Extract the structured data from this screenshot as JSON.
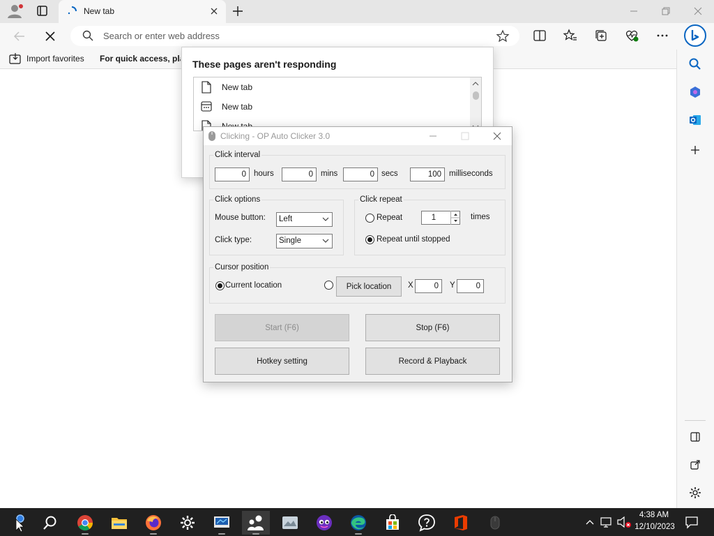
{
  "browser": {
    "tab": {
      "title": "New tab"
    },
    "address_bar": {
      "placeholder": "Search or enter web address"
    },
    "favorites_bar": {
      "import_label": "Import favorites",
      "quick_access_text": "For quick access, plac"
    }
  },
  "not_responding_dialog": {
    "title": "These pages aren't responding",
    "items": [
      {
        "label": "New tab",
        "icon": "page-icon"
      },
      {
        "label": "New tab",
        "icon": "app-window-icon"
      },
      {
        "label": "New tab",
        "icon": "page-icon"
      }
    ]
  },
  "auto_clicker": {
    "window_title": "Clicking - OP Auto Clicker 3.0",
    "click_interval": {
      "group_label": "Click interval",
      "hours": "0",
      "hours_label": "hours",
      "mins": "0",
      "mins_label": "mins",
      "secs": "0",
      "secs_label": "secs",
      "milliseconds": "100",
      "milliseconds_label": "milliseconds"
    },
    "click_options": {
      "group_label": "Click options",
      "mouse_button_label": "Mouse button:",
      "mouse_button_value": "Left",
      "click_type_label": "Click type:",
      "click_type_value": "Single"
    },
    "click_repeat": {
      "group_label": "Click repeat",
      "repeat_label": "Repeat",
      "repeat_count": "1",
      "times_label": "times",
      "repeat_until_stopped_label": "Repeat until stopped",
      "selected": "repeat_until_stopped"
    },
    "cursor_position": {
      "group_label": "Cursor position",
      "current_location_label": "Current location",
      "pick_location_label": "Pick location",
      "x_label": "X",
      "x_value": "0",
      "y_label": "Y",
      "y_value": "0",
      "selected": "current_location"
    },
    "buttons": {
      "start": "Start (F6)",
      "stop": "Stop (F6)",
      "hotkey": "Hotkey setting",
      "record": "Record & Playback"
    }
  },
  "taskbar": {
    "apps": [
      "start-icon",
      "search-icon",
      "chrome-icon",
      "file-explorer-icon",
      "firefox-icon",
      "settings-icon",
      "remote-desktop-icon",
      "people-icon",
      "media-player-icon",
      "game-icon",
      "edge-icon",
      "store-icon",
      "help-icon",
      "office-icon",
      "mouse-icon"
    ],
    "clock_time": "4:38 AM",
    "clock_date": "12/10/2023"
  },
  "colors": {
    "edge_blue": "#0a66c2",
    "taskbar_bg": "#202020",
    "dialog_bg": "#f0f0f0"
  }
}
